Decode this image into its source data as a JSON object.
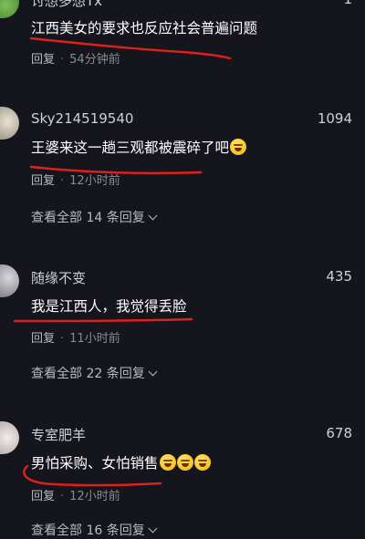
{
  "top_comment": {
    "username_partial": "讨想多想Tx",
    "likes_partial": "1",
    "text": "江西美女的要求也反应社会普遍问题",
    "reply_label": "回复",
    "time": "54分钟前"
  },
  "comments": [
    {
      "username": "Sky214519540",
      "likes": "1094",
      "text": "王婆来这一趟三观都被震碎了吧",
      "emojis": 1,
      "reply_label": "回复",
      "time": "12小时前",
      "view_more": "查看全部 14 条回复"
    },
    {
      "username": "随缘不变",
      "likes": "435",
      "text": "我是江西人，我觉得丢脸",
      "emojis": 0,
      "reply_label": "回复",
      "time": "11小时前",
      "view_more": "查看全部 22 条回复"
    },
    {
      "username": "专室肥羊",
      "likes": "678",
      "text": "男怕采购、女怕销售",
      "emojis": 3,
      "reply_label": "回复",
      "time": "12小时前",
      "view_more": "查看全部 16 条回复"
    }
  ],
  "colors": {
    "background": "#15151e",
    "underline": "#e0201c"
  }
}
